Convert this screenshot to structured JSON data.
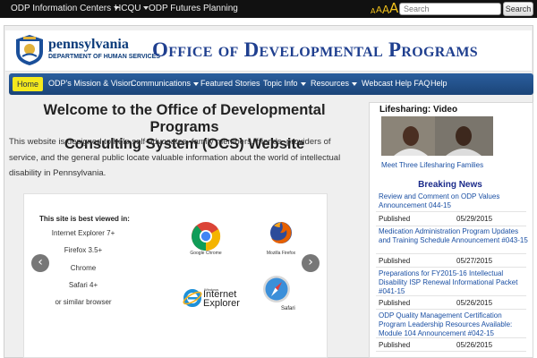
{
  "topbar": {
    "links": [
      {
        "label": "ODP Information Centers",
        "has_caret": true
      },
      {
        "label": "HCQU",
        "has_caret": true
      },
      {
        "label": "ODP Futures Planning",
        "has_caret": false
      }
    ],
    "font_sizes": [
      "A",
      "A",
      "A",
      "A"
    ],
    "search": {
      "placeholder": "Search",
      "button": "Search"
    }
  },
  "header": {
    "logo_name": "pennsylvania",
    "logo_dept": "DEPARTMENT OF HUMAN SERVICES",
    "title": "Office of Developmental Programs"
  },
  "nav": {
    "items": [
      {
        "label": "Home",
        "active": true,
        "caret": false
      },
      {
        "label": "ODP's Mission & Vision",
        "caret": false
      },
      {
        "label": "Communications",
        "caret": true
      },
      {
        "label": "Featured Stories",
        "caret": false
      },
      {
        "label": "Topic Info",
        "caret": true
      },
      {
        "label": "Resources",
        "caret": true
      },
      {
        "label": "Webcast Help FAQ",
        "caret": false
      },
      {
        "label": "Help",
        "caret": false
      }
    ]
  },
  "main": {
    "welcome_line1": "Welcome to the Office of Developmental Programs",
    "welcome_line2": "Consulting System (OCS) Website",
    "intro": "This website is designed to help self-advocates, family members, friends, providers of service, and the general public locate valuable information about the world of intellectual disability in Pennsylvania.",
    "slider": {
      "heading": "This site is best viewed in:",
      "browsers": [
        "Internet Explorer 7+",
        "Firefox 3.5+",
        "Chrome",
        "Safari 4+",
        "or similar browser"
      ],
      "logo_labels": {
        "chrome": "Google Chrome",
        "firefox": "Mozilla Firefox",
        "ie_small": "Windows",
        "ie_big1": "Internet",
        "ie_big2": "Explorer",
        "safari": "Safari"
      }
    }
  },
  "sidebar": {
    "lifesharing_title": "Lifesharing: Video",
    "lifesharing_link": "Meet Three Lifesharing Families",
    "news_heading": "Breaking News",
    "news": [
      {
        "title": "Review and Comment on ODP Values Announcement 044-15",
        "label": "Published",
        "date": "05/29/2015"
      },
      {
        "title": "Medication Administration Program Updates and Training Schedule Announcement #043-15",
        "label": "Published",
        "date": "05/27/2015"
      },
      {
        "title": "Preparations for FY2015-16 Intellectual Disability ISP Renewal Informational Packet #041-15",
        "label": "Published",
        "date": "05/26/2015"
      },
      {
        "title": "ODP Quality Management Certification Program Leadership Resources Available: Module 104 Announcement #042-15",
        "label": "Published",
        "date": "05/26/2015"
      }
    ]
  },
  "colors": {
    "accent_yellow": "#f4e81c",
    "nav_blue": "#1b4478",
    "link_blue": "#1a4fa3",
    "title_blue": "#1f3f8f"
  },
  "icons": [
    "seal-icon",
    "chrome-icon",
    "firefox-icon",
    "ie-icon",
    "safari-icon",
    "chevron-left-icon",
    "chevron-right-icon"
  ]
}
